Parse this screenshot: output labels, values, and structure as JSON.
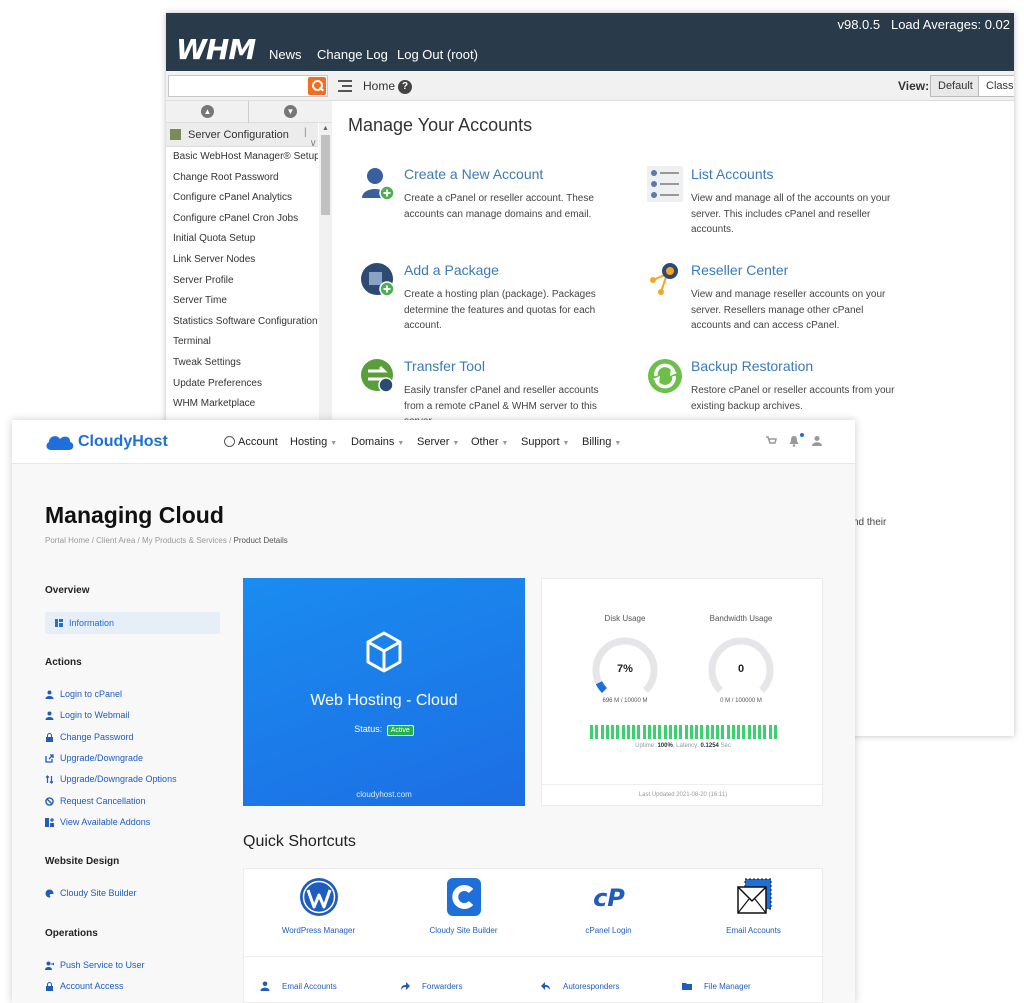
{
  "whm": {
    "logo": "WHM",
    "nav": [
      "News",
      "Change Log",
      "Log Out (root)"
    ],
    "version": "v98.0.5",
    "load_label": "Load Averages: 0.02",
    "search_placeholder": "",
    "breadcrumb_home": "Home",
    "help": "?",
    "view_label": "View:",
    "view_options": [
      "Default",
      "Classic"
    ],
    "sidebar_header": "Server Configuration",
    "sidebar_items": [
      "Basic WebHost Manager® Setup",
      "Change Root Password",
      "Configure cPanel Analytics",
      "Configure cPanel Cron Jobs",
      "Initial Quota Setup",
      "Link Server Nodes",
      "Server Profile",
      "Server Time",
      "Statistics Software Configuration",
      "Terminal",
      "Tweak Settings",
      "Update Preferences",
      "WHM Marketplace"
    ],
    "page_title": "Manage Your Accounts",
    "cards": [
      {
        "title": "Create a New Account",
        "desc": "Create a cPanel or reseller account. These accounts can manage domains and email.",
        "icon": "add-user-icon"
      },
      {
        "title": "List Accounts",
        "desc": "View and manage all of the accounts on your server. This includes cPanel and reseller accounts.",
        "icon": "list-icon"
      },
      {
        "title": "Add a Package",
        "desc": "Create a hosting plan (package). Packages determine the features and quotas for each account.",
        "icon": "package-icon"
      },
      {
        "title": "Reseller Center",
        "desc": "View and manage reseller accounts on your server. Resellers manage other cPanel accounts and can access cPanel.",
        "icon": "reseller-icon"
      },
      {
        "title": "Transfer Tool",
        "desc": "Easily transfer cPanel and reseller accounts from a remote cPanel & WHM server to this server.",
        "icon": "transfer-icon"
      },
      {
        "title": "Backup Restoration",
        "desc": "Restore cPanel or reseller accounts from your existing backup archives.",
        "icon": "restore-icon"
      }
    ],
    "partial_text": "nd their"
  },
  "cloudyhost": {
    "brand": "CloudyHost",
    "nav": [
      {
        "label": "Account",
        "caret": false
      },
      {
        "label": "Hosting",
        "caret": true
      },
      {
        "label": "Domains",
        "caret": true
      },
      {
        "label": "Server",
        "caret": true
      },
      {
        "label": "Other",
        "caret": true
      },
      {
        "label": "Support",
        "caret": true
      },
      {
        "label": "Billing",
        "caret": true
      }
    ],
    "page_title": "Managing Cloud",
    "breadcrumb": [
      "Portal Home",
      "Client Area",
      "My Products & Services",
      "Product Details"
    ],
    "breadcrumb_sep": " / ",
    "sidebar": {
      "overview_title": "Overview",
      "information": "Information",
      "actions_title": "Actions",
      "actions": [
        "Login to cPanel",
        "Login to Webmail",
        "Change Password",
        "Upgrade/Downgrade",
        "Upgrade/Downgrade Options",
        "Request Cancellation",
        "View Available Addons"
      ],
      "design_title": "Website Design",
      "design": [
        "Cloudy Site Builder"
      ],
      "operations_title": "Operations",
      "operations": [
        "Push Service to User",
        "Account Access"
      ]
    },
    "product": {
      "name": "Web Hosting - Cloud",
      "status_label": "Status:",
      "status": "Active",
      "domain": "cloudyhost.com"
    },
    "usage": {
      "disk_label": "Disk Usage",
      "disk_value": "7%",
      "disk_fraction": 0.07,
      "disk_amount": "696 M / 10000 M",
      "bw_label": "Bandwidth Usage",
      "bw_value": "0",
      "bw_fraction": 0,
      "bw_amount": "0 M / 100000 M",
      "uptime_label": "Uptime:",
      "uptime": "100%",
      "latency_label": "Latency:",
      "latency": "0.1254",
      "latency_unit": "Sec",
      "updated": "Last Updated 2021-08-20 (16:11)"
    },
    "shortcuts_title": "Quick Shortcuts",
    "shortcut_tiles": [
      "WordPress Manager",
      "Cloudy Site Builder",
      "cPanel Login",
      "Email Accounts"
    ],
    "shortcut_links": [
      "Email Accounts",
      "Forwarders",
      "Autoresponders",
      "File Manager"
    ],
    "colors": {
      "brand": "#1e6fd9",
      "whm_header": "#293a4a",
      "active": "#21b14d",
      "uptime_bar": "#3bd16f"
    }
  }
}
